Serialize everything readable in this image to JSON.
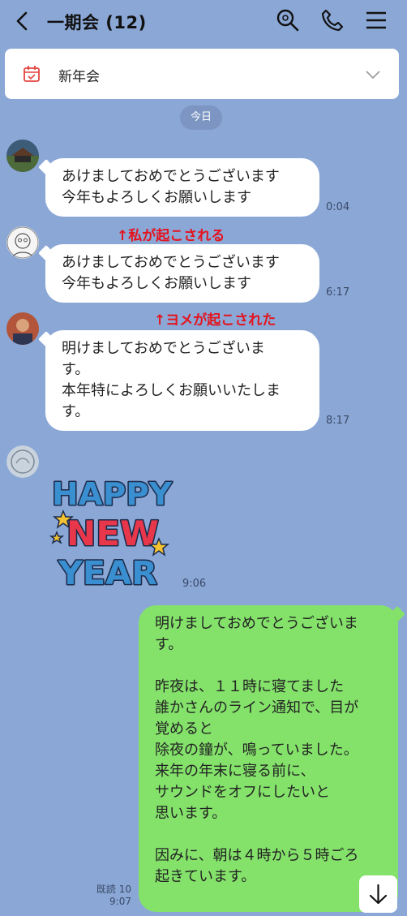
{
  "header": {
    "title": "一期会 (12)",
    "icons": [
      "back-icon",
      "search-icon",
      "phone-icon",
      "menu-icon"
    ]
  },
  "pinned": {
    "text": "新年会",
    "icons": [
      "calendar-icon",
      "chevron-down-icon"
    ]
  },
  "date_separator": "今日",
  "messages": [
    {
      "lines": [
        "あけましておめでとうございます",
        "今年もよろしくお願いします"
      ],
      "time": "0:04"
    },
    {
      "lines": [
        "あけましておめでとうございます",
        "今年もよろしくお願いします"
      ],
      "time": "6:17"
    },
    {
      "lines": [
        "明けましておめでとうございま",
        "す。",
        "本年特によろしくお願いいたしま",
        "す。"
      ],
      "time": "8:17"
    },
    {
      "sticker_text": [
        "HAPPY",
        "NEW",
        "YEAR"
      ],
      "time": "9:06"
    },
    {
      "lines": [
        "明けましておめでとうございま",
        "す。",
        "",
        "昨夜は、１１時に寝てました",
        "誰かさんのライン通知で、目が",
        "覚めると",
        "除夜の鐘が、鳴っていました。",
        "来年の年末に寝る前に、",
        "サウンドをオフにしたいと",
        "思います。",
        "",
        "因みに、朝は４時から５時ごろ",
        "起きています。"
      ],
      "read": "既読 10",
      "time": "9:07"
    }
  ],
  "annotations": [
    "↑私が起こされる",
    "↑ヨメが起こされた"
  ],
  "colors": {
    "background": "#8aa7d6",
    "my_bubble": "#84e26b",
    "annotation": "#e4141e"
  }
}
